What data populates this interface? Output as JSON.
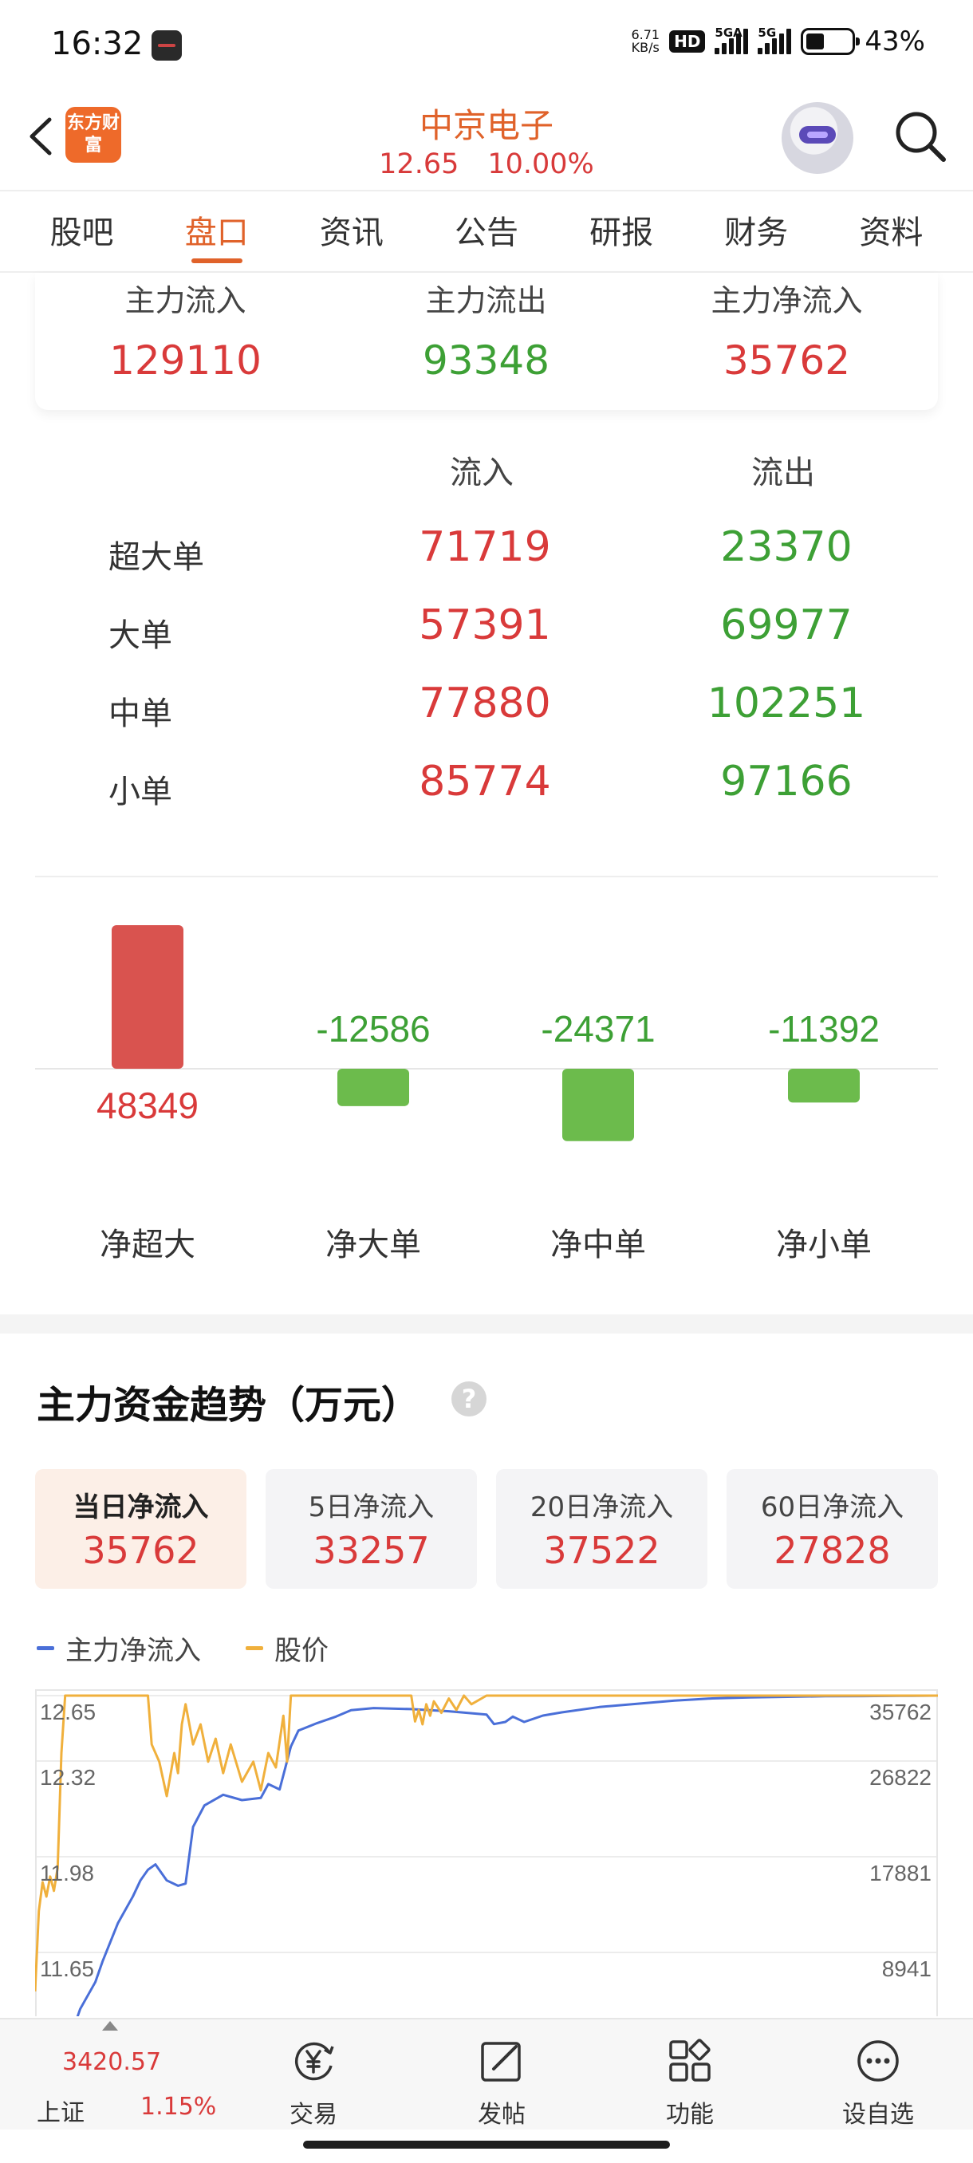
{
  "status_bar": {
    "time": "16:32",
    "net_speed_value": "6.71",
    "net_speed_unit": "KB/s",
    "hd_badge": "HD",
    "signal1_label": "5GA",
    "signal2_label": "5G",
    "battery_pct": "43%"
  },
  "header": {
    "logo_text": "东方财富",
    "stock_name": "中京电子",
    "price": "12.65",
    "change_pct": "10.00%"
  },
  "tabs": [
    "股吧",
    "盘口",
    "资讯",
    "公告",
    "研报",
    "财务",
    "资料"
  ],
  "active_tab": "盘口",
  "main_flow": {
    "inflow_label": "主力流入",
    "inflow_value": "129110",
    "outflow_label": "主力流出",
    "outflow_value": "93348",
    "net_label": "主力净流入",
    "net_value": "35762"
  },
  "orders": {
    "header_in": "流入",
    "header_out": "流出",
    "rows": [
      {
        "name": "超大单",
        "in": "71719",
        "out": "23370"
      },
      {
        "name": "大单",
        "in": "57391",
        "out": "69977"
      },
      {
        "name": "中单",
        "in": "77880",
        "out": "102251"
      },
      {
        "name": "小单",
        "in": "85774",
        "out": "97166"
      }
    ]
  },
  "net_bars": {
    "bars": [
      {
        "label": "净超大",
        "value": 48349,
        "display": "48349"
      },
      {
        "label": "净大单",
        "value": -12586,
        "display": "-12586"
      },
      {
        "label": "净中单",
        "value": -24371,
        "display": "-24371"
      },
      {
        "label": "净小单",
        "value": -11392,
        "display": "-11392"
      }
    ],
    "positive_color": "#d9534f",
    "negative_color": "#6cbb4c"
  },
  "trend": {
    "title": "主力资金趋势（万元）",
    "help_icon": "?",
    "periods": [
      {
        "label": "当日净流入",
        "value": "35762",
        "active": true
      },
      {
        "label": "5日净流入",
        "value": "33257",
        "active": false
      },
      {
        "label": "20日净流入",
        "value": "37522",
        "active": false
      },
      {
        "label": "60日净流入",
        "value": "27828",
        "active": false
      }
    ],
    "legend": [
      {
        "name": "主力净流入",
        "color": "#4a6fd8"
      },
      {
        "name": "股价",
        "color": "#f0b03c"
      }
    ]
  },
  "chart_data": {
    "type": "line",
    "title": "",
    "xlabel": "",
    "ylabel": "",
    "y_left_ticks": [
      "12.65",
      "12.32",
      "11.98",
      "11.65"
    ],
    "y_right_ticks": [
      "35762",
      "26822",
      "17881",
      "8941"
    ],
    "y_left_range": [
      11.5,
      12.65
    ],
    "y_right_range": [
      0,
      35762
    ],
    "series": [
      {
        "name": "主力净流入",
        "color": "#4a6fd8",
        "axis": "right",
        "x": [
          0,
          3,
          5,
          8,
          10,
          12,
          16,
          18,
          22,
          26,
          28,
          30,
          32,
          35,
          38,
          40,
          42,
          45,
          50,
          55,
          60,
          62,
          65,
          68,
          70,
          75,
          80,
          84,
          90,
          100,
          110,
          120,
          122,
          125,
          127,
          130,
          135,
          140,
          150,
          160,
          170,
          175,
          180,
          190,
          200,
          210,
          220,
          230,
          240
        ],
        "y": [
          4000,
          2000,
          0,
          0,
          4500,
          6500,
          9000,
          11000,
          14500,
          17000,
          18500,
          19500,
          20000,
          18500,
          18000,
          18200,
          23500,
          25500,
          26500,
          26000,
          26200,
          27500,
          27000,
          31000,
          32500,
          33200,
          33800,
          34400,
          34600,
          34500,
          34300,
          34000,
          33100,
          33300,
          33800,
          33300,
          33900,
          34200,
          34700,
          35000,
          35300,
          35400,
          35500,
          35600,
          35650,
          35700,
          35720,
          35740,
          35762
        ]
      },
      {
        "name": "股价",
        "color": "#f0b03c",
        "axis": "left",
        "x": [
          0,
          1,
          2,
          3,
          4,
          5,
          6,
          7,
          8,
          10,
          20,
          30,
          31,
          33,
          35,
          37,
          38,
          39,
          40,
          42,
          44,
          46,
          48,
          50,
          52,
          55,
          58,
          60,
          62,
          64,
          66,
          67,
          68,
          70,
          72,
          80,
          90,
          100,
          101,
          102,
          103,
          104,
          105,
          106,
          108,
          110,
          112,
          114,
          116,
          120,
          140,
          160,
          180,
          200,
          220,
          240
        ],
        "y": [
          11.62,
          11.9,
          12.0,
          11.95,
          12.02,
          11.97,
          12.05,
          12.45,
          12.65,
          12.65,
          12.65,
          12.65,
          12.48,
          12.42,
          12.3,
          12.45,
          12.38,
          12.55,
          12.62,
          12.48,
          12.55,
          12.42,
          12.5,
          12.38,
          12.48,
          12.35,
          12.42,
          12.32,
          12.45,
          12.4,
          12.58,
          12.42,
          12.65,
          12.65,
          12.65,
          12.65,
          12.65,
          12.65,
          12.56,
          12.6,
          12.55,
          12.62,
          12.58,
          12.63,
          12.59,
          12.64,
          12.6,
          12.65,
          12.62,
          12.65,
          12.65,
          12.65,
          12.65,
          12.65,
          12.65,
          12.65
        ]
      }
    ]
  },
  "bottom_nav": {
    "index_value": "3420.57",
    "index_name": "上证",
    "index_pct": "1.15%",
    "items": [
      {
        "label": "交易",
        "icon": "trade-yen-icon"
      },
      {
        "label": "发帖",
        "icon": "compose-icon"
      },
      {
        "label": "功能",
        "icon": "grid-icon"
      },
      {
        "label": "设自选",
        "icon": "more-dots-icon"
      }
    ]
  }
}
